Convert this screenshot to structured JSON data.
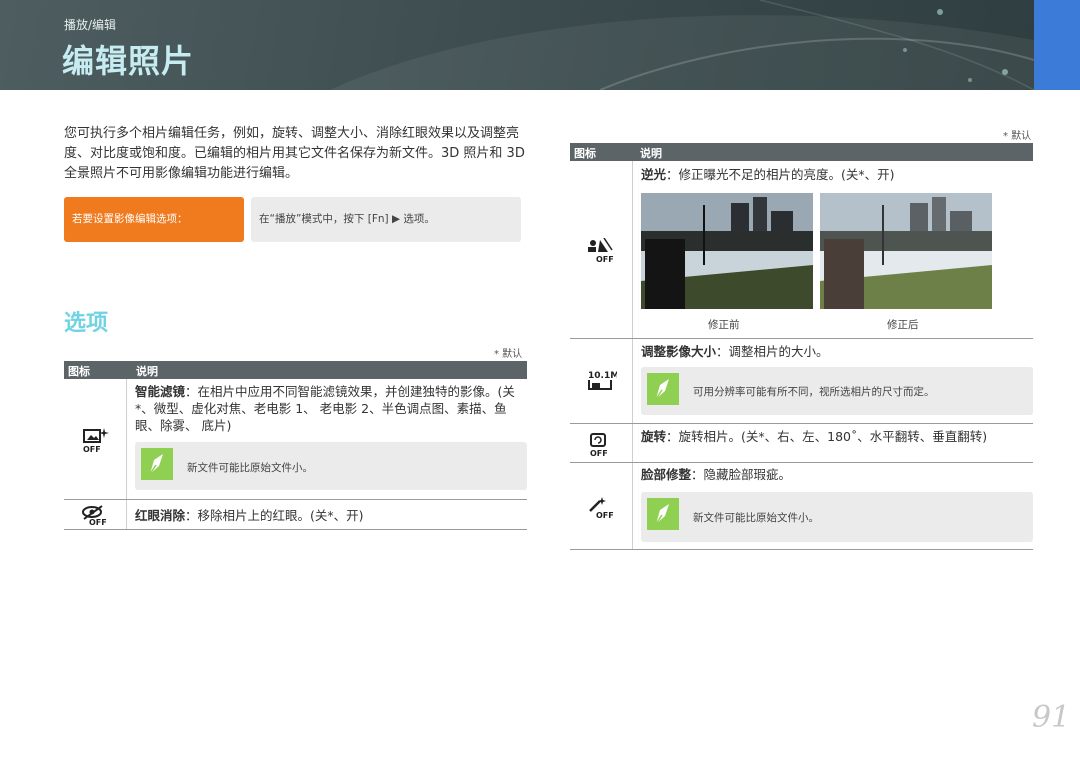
{
  "header": {
    "breadcrumb": "播放/编辑",
    "title": "编辑照片"
  },
  "intro": "您可执行多个相片编辑任务，例如，旋转、调整大小、消除红眼效果以及调整亮度、对比度或饱和度。已编辑的相片用其它文件名保存为新文件。3D 照片和 3D 全景照片不可用影像编辑功能进行编辑。",
  "tip": {
    "label": "若要设置影像编辑选项：",
    "text": "在“播放”模式中，按下 [Fn] ▶ 选项。"
  },
  "section_title": "选项",
  "default_note": "* 默认",
  "table_headers": {
    "icon": "图标",
    "desc": "说明"
  },
  "left_rows": {
    "smart_filter": {
      "name": "智能滤镜",
      "desc": "：在相片中应用不同智能滤镜效果，并创建独特的影像。(关*、微型、虚化对焦、老电影 1、 老电影 2、半色调点图、素描、鱼眼、除雾、 底片)",
      "note": "新文件可能比原始文件小。",
      "icon": "smart-filter-off-icon"
    },
    "red_eye": {
      "name": "红眼消除",
      "desc": "：移除相片上的红眼。(关*、开)",
      "icon": "red-eye-off-icon"
    }
  },
  "right_rows": {
    "backlight": {
      "name": "逆光",
      "desc": "：修正曝光不足的相片的亮度。(关*、开)",
      "before": "修正前",
      "after": "修正后",
      "icon": "backlight-off-icon"
    },
    "resize": {
      "name": "调整影像大小",
      "desc": "：调整相片的大小。",
      "note": "可用分辨率可能有所不同，视所选相片的尺寸而定。",
      "icon": "resize-icon"
    },
    "rotate": {
      "name": "旋转",
      "desc": "：旋转相片。(关*、右、左、180˚、水平翻转、垂直翻转)",
      "icon": "rotate-off-icon"
    },
    "face_retouch": {
      "name": "脸部修整",
      "desc": "：隐藏脸部瑕疵。",
      "note": "新文件可能比原始文件小。",
      "icon": "face-retouch-off-icon"
    }
  },
  "page_number": "91",
  "colors": {
    "accent": "#6fd3e3",
    "tip": "#f07a1e",
    "header": "#3a4a4c",
    "corner": "#3d7bd9"
  }
}
